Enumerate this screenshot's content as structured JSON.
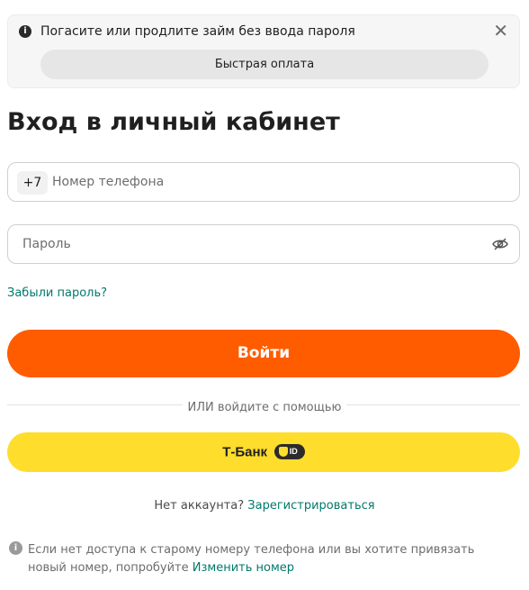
{
  "banner": {
    "info_icon": "info-icon",
    "text": "Погасите или продлите займ без ввода пароля",
    "close_icon": "close-icon",
    "close_glyph": "✕",
    "button_label": "Быстрая оплата"
  },
  "page_title": "Вход в личный кабинет",
  "phone": {
    "prefix": "+7",
    "placeholder": "Номер телефона",
    "value": ""
  },
  "password": {
    "placeholder": "Пароль",
    "value": "",
    "toggle_icon": "eye-off-icon"
  },
  "forgot_password": "Забыли пароль?",
  "login_button": "Войти",
  "divider_text": "ИЛИ войдите с помощью",
  "tbank": {
    "label": "Т-Банк",
    "badge_text": "ID"
  },
  "no_account": {
    "text": "Нет аккаунта?",
    "link": "Зарегистрироваться"
  },
  "footer": {
    "info_icon": "info-icon",
    "text": "Если нет доступа к старому номеру телефона или вы хотите привязать новый номер, попробуйте",
    "link": "Изменить номер"
  },
  "colors": {
    "accent_orange": "#ff5c00",
    "tbank_yellow": "#ffdd2d",
    "link_teal": "#00796b"
  }
}
